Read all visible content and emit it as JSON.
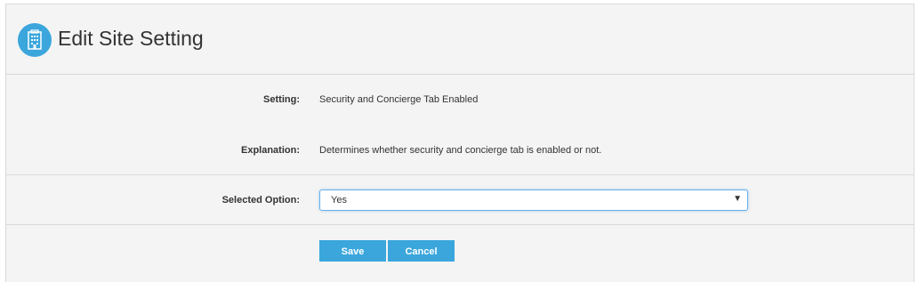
{
  "header": {
    "title": "Edit Site Setting",
    "icon": "building-icon"
  },
  "form": {
    "setting_label": "Setting:",
    "setting_value": "Security and Concierge Tab Enabled",
    "explanation_label": "Explanation:",
    "explanation_value": "Determines whether security and concierge tab is enabled or not.",
    "selected_option_label": "Selected Option:",
    "selected_option_value": "Yes"
  },
  "actions": {
    "save_label": "Save",
    "cancel_label": "Cancel"
  },
  "colors": {
    "accent": "#3aa6dc",
    "panel_bg": "#f4f4f4",
    "border": "#d9d9d9"
  }
}
